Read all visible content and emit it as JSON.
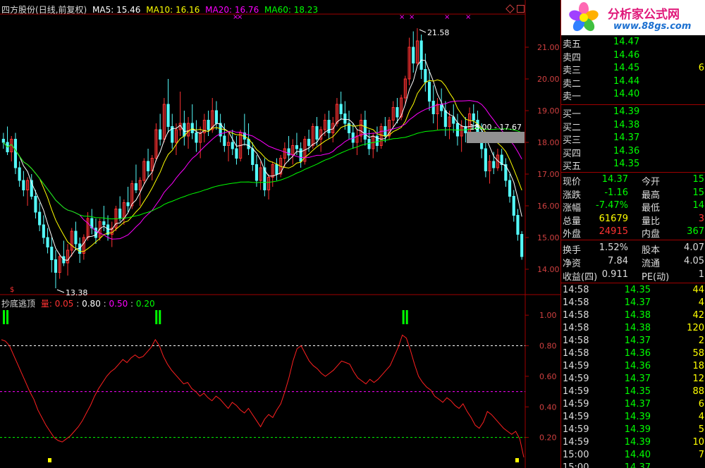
{
  "header": {
    "stock": "四方股份",
    "period": "(日线,前复权)",
    "ma5": "MA5: 15.46",
    "ma10": "MA10: 16.16",
    "ma20": "MA20: 16.76",
    "ma60": "MA60: 18.23"
  },
  "indicator_header": {
    "name": "抄底逃顶",
    "qty_label": "量:",
    "v1": "0.05",
    "v2": "0.80",
    "v3": "0.50",
    "v4": "0.20"
  },
  "price_labels": {
    "high": "21.58",
    "low": "13.38",
    "range": "18.00 - 17.67"
  },
  "logo": {
    "title": "分析家公式网",
    "url": "www.88gs.com"
  },
  "colors": {
    "up": "#ff3232",
    "down": "#54fcfc",
    "ma5": "#ffffff",
    "ma10": "#ffff00",
    "ma20": "#ff00ff",
    "ma60": "#00ff00",
    "grid": "#a00000",
    "price_green": "#00ff00"
  },
  "order_book": {
    "sell": [
      {
        "label": "卖五",
        "price": "14.47",
        "vol": ""
      },
      {
        "label": "卖四",
        "price": "14.46",
        "vol": ""
      },
      {
        "label": "卖三",
        "price": "14.45",
        "vol": "6"
      },
      {
        "label": "卖二",
        "price": "14.44",
        "vol": ""
      },
      {
        "label": "卖一",
        "price": "14.40",
        "vol": ""
      }
    ],
    "buy": [
      {
        "label": "买一",
        "price": "14.39",
        "vol": ""
      },
      {
        "label": "买二",
        "price": "14.38",
        "vol": ""
      },
      {
        "label": "买三",
        "price": "14.37",
        "vol": ""
      },
      {
        "label": "买四",
        "price": "14.36",
        "vol": ""
      },
      {
        "label": "买五",
        "price": "14.35",
        "vol": ""
      }
    ]
  },
  "quote": [
    {
      "l1": "现价",
      "v1": "14.37",
      "l2": "今开",
      "v2": "15",
      "c1": "#00ff00",
      "c2": "#00ff00"
    },
    {
      "l1": "涨跌",
      "v1": "-1.16",
      "l2": "最高",
      "v2": "15",
      "c1": "#00ff00",
      "c2": "#00ff00"
    },
    {
      "l1": "涨幅",
      "v1": "-7.47%",
      "l2": "最低",
      "v2": "14",
      "c1": "#00ff00",
      "c2": "#00ff00"
    },
    {
      "l1": "总量",
      "v1": "61679",
      "l2": "量比",
      "v2": "3",
      "c1": "#ffff00",
      "c2": "#ff3232"
    },
    {
      "l1": "外盘",
      "v1": "24915",
      "l2": "内盘",
      "v2": "367",
      "c1": "#ff3232",
      "c2": "#00ff00"
    }
  ],
  "fundamentals": [
    {
      "l1": "换手",
      "v1": "1.52%",
      "l2": "股本",
      "v2": "4.07"
    },
    {
      "l1": "净资",
      "v1": "7.84",
      "l2": "流通",
      "v2": "4.05"
    },
    {
      "l1": "收益(四)",
      "v1": "0.911",
      "l2": "PE(动)",
      "v2": "1"
    }
  ],
  "ticks": [
    {
      "t": "14:58",
      "p": "14.35",
      "v": "44"
    },
    {
      "t": "14:58",
      "p": "14.37",
      "v": "4"
    },
    {
      "t": "14:58",
      "p": "14.38",
      "v": "42"
    },
    {
      "t": "14:58",
      "p": "14.38",
      "v": "120"
    },
    {
      "t": "14:58",
      "p": "14.37",
      "v": "2"
    },
    {
      "t": "14:58",
      "p": "14.36",
      "v": "58"
    },
    {
      "t": "14:59",
      "p": "14.36",
      "v": "18"
    },
    {
      "t": "14:59",
      "p": "14.37",
      "v": "12"
    },
    {
      "t": "14:59",
      "p": "14.35",
      "v": "88"
    },
    {
      "t": "14:59",
      "p": "14.37",
      "v": "6"
    },
    {
      "t": "14:59",
      "p": "14.39",
      "v": "4"
    },
    {
      "t": "14:59",
      "p": "14.39",
      "v": "5"
    },
    {
      "t": "14:59",
      "p": "14.39",
      "v": "10"
    },
    {
      "t": "15:00",
      "p": "14.40",
      "v": "7"
    },
    {
      "t": "15:00",
      "p": "14.37",
      "v": ""
    }
  ],
  "chart_data": {
    "type": "candlestick",
    "price_axis": {
      "ticks": [
        "21.00",
        "20.00",
        "19.00",
        "18.00",
        "17.00",
        "16.00",
        "15.00",
        "14.00"
      ],
      "values": [
        21,
        20,
        19,
        18,
        17,
        16,
        15,
        14
      ],
      "ylim": [
        13.2,
        22.0
      ]
    },
    "indicator_axis": {
      "ticks": [
        "1.00",
        "0.80",
        "0.60",
        "0.40",
        "0.20"
      ],
      "values": [
        1.0,
        0.8,
        0.6,
        0.4,
        0.2
      ],
      "ylim": [
        0.0,
        1.07
      ]
    },
    "indicator_levels": [
      {
        "value": 0.8,
        "color": "#ffffff"
      },
      {
        "value": 0.5,
        "color": "#ff00ff"
      },
      {
        "value": 0.2,
        "color": "#00ff00"
      }
    ],
    "candles": [
      [
        18.1,
        18.3,
        17.8,
        18.0
      ],
      [
        18.0,
        18.5,
        17.6,
        17.7
      ],
      [
        17.7,
        18.2,
        17.4,
        18.1
      ],
      [
        18.1,
        18.3,
        17.0,
        17.2
      ],
      [
        17.2,
        17.4,
        16.6,
        16.8
      ],
      [
        16.8,
        17.1,
        16.3,
        16.5
      ],
      [
        16.5,
        16.9,
        16.0,
        16.8
      ],
      [
        16.8,
        17.0,
        16.2,
        16.3
      ],
      [
        16.3,
        16.5,
        15.6,
        15.8
      ],
      [
        15.8,
        16.1,
        15.2,
        15.4
      ],
      [
        15.4,
        15.7,
        14.8,
        15.0
      ],
      [
        15.0,
        15.3,
        14.5,
        14.7
      ],
      [
        14.7,
        15.0,
        13.9,
        14.3
      ],
      [
        14.3,
        14.6,
        13.4,
        13.9
      ],
      [
        13.9,
        14.5,
        13.7,
        14.4
      ],
      [
        14.4,
        14.9,
        14.1,
        14.2
      ],
      [
        14.2,
        14.8,
        13.8,
        14.6
      ],
      [
        14.6,
        15.3,
        14.4,
        15.2
      ],
      [
        15.2,
        15.5,
        14.6,
        14.8
      ],
      [
        14.8,
        15.0,
        14.2,
        14.5
      ],
      [
        14.5,
        15.1,
        14.3,
        15.0
      ],
      [
        15.0,
        15.8,
        14.9,
        15.6
      ],
      [
        15.6,
        15.9,
        15.1,
        15.3
      ],
      [
        15.3,
        15.6,
        14.8,
        15.0
      ],
      [
        15.0,
        15.6,
        14.9,
        15.5
      ],
      [
        15.5,
        16.0,
        15.2,
        15.4
      ],
      [
        15.4,
        15.7,
        14.9,
        15.1
      ],
      [
        15.1,
        15.5,
        14.7,
        15.3
      ],
      [
        15.3,
        16.0,
        15.2,
        15.9
      ],
      [
        15.9,
        16.3,
        15.5,
        15.6
      ],
      [
        15.6,
        16.2,
        15.4,
        16.1
      ],
      [
        16.1,
        16.6,
        15.8,
        16.0
      ],
      [
        16.0,
        16.8,
        15.9,
        16.7
      ],
      [
        16.7,
        17.3,
        16.4,
        16.5
      ],
      [
        16.5,
        16.9,
        16.0,
        16.8
      ],
      [
        16.8,
        17.5,
        16.7,
        17.4
      ],
      [
        17.4,
        17.8,
        16.9,
        17.1
      ],
      [
        17.1,
        17.6,
        16.8,
        17.5
      ],
      [
        17.5,
        18.6,
        17.4,
        18.4
      ],
      [
        18.4,
        18.9,
        17.9,
        18.1
      ],
      [
        18.1,
        19.4,
        18.0,
        19.2
      ],
      [
        19.2,
        20.0,
        18.3,
        18.5
      ],
      [
        18.5,
        18.9,
        17.8,
        18.0
      ],
      [
        18.0,
        18.6,
        17.6,
        18.4
      ],
      [
        18.4,
        19.6,
        18.2,
        18.6
      ],
      [
        18.6,
        19.0,
        17.9,
        18.2
      ],
      [
        18.2,
        18.8,
        17.8,
        18.6
      ],
      [
        18.6,
        19.2,
        18.1,
        18.3
      ],
      [
        18.3,
        18.7,
        17.7,
        18.0
      ],
      [
        18.0,
        18.5,
        17.5,
        18.3
      ],
      [
        18.3,
        18.9,
        18.0,
        18.7
      ],
      [
        18.7,
        19.0,
        18.2,
        18.4
      ],
      [
        18.4,
        19.4,
        18.3,
        19.0
      ],
      [
        19.0,
        19.3,
        18.4,
        18.6
      ],
      [
        18.6,
        18.9,
        18.0,
        18.2
      ],
      [
        18.2,
        18.6,
        17.7,
        17.9
      ],
      [
        17.9,
        18.3,
        17.4,
        18.0
      ],
      [
        18.0,
        18.4,
        17.6,
        17.8
      ],
      [
        17.8,
        18.2,
        17.3,
        17.5
      ],
      [
        17.5,
        18.4,
        17.4,
        18.3
      ],
      [
        18.3,
        18.9,
        17.9,
        18.1
      ],
      [
        18.1,
        18.6,
        17.6,
        17.8
      ],
      [
        17.8,
        18.0,
        17.1,
        17.3
      ],
      [
        17.3,
        17.6,
        16.6,
        16.8
      ],
      [
        16.8,
        17.4,
        16.5,
        17.2
      ],
      [
        17.2,
        17.5,
        16.3,
        16.5
      ],
      [
        16.5,
        17.0,
        16.2,
        16.9
      ],
      [
        16.9,
        17.4,
        16.6,
        17.3
      ],
      [
        17.3,
        17.5,
        16.8,
        17.0
      ],
      [
        17.0,
        17.6,
        16.9,
        17.5
      ],
      [
        17.5,
        18.0,
        17.2,
        17.8
      ],
      [
        17.8,
        18.2,
        17.4,
        17.6
      ],
      [
        17.6,
        18.1,
        17.3,
        17.9
      ],
      [
        17.9,
        18.3,
        17.6,
        17.8
      ],
      [
        17.8,
        18.0,
        17.2,
        17.4
      ],
      [
        17.4,
        18.2,
        17.3,
        18.1
      ],
      [
        18.1,
        18.4,
        17.7,
        17.9
      ],
      [
        17.9,
        18.6,
        17.8,
        18.5
      ],
      [
        18.5,
        18.8,
        17.9,
        18.1
      ],
      [
        18.1,
        18.5,
        17.7,
        18.4
      ],
      [
        18.4,
        18.9,
        18.2,
        18.7
      ],
      [
        18.7,
        19.0,
        18.1,
        18.3
      ],
      [
        18.3,
        18.8,
        18.0,
        18.6
      ],
      [
        18.6,
        19.4,
        18.5,
        19.2
      ],
      [
        19.2,
        19.6,
        18.7,
        18.9
      ],
      [
        18.9,
        19.3,
        18.4,
        18.6
      ],
      [
        18.6,
        19.0,
        18.1,
        18.3
      ],
      [
        18.3,
        18.6,
        17.8,
        18.0
      ],
      [
        18.0,
        18.4,
        17.6,
        18.2
      ],
      [
        18.2,
        18.9,
        18.0,
        18.7
      ],
      [
        18.7,
        19.0,
        17.9,
        18.1
      ],
      [
        18.1,
        18.4,
        17.6,
        17.8
      ],
      [
        17.8,
        18.3,
        17.5,
        18.2
      ],
      [
        18.2,
        18.5,
        17.7,
        17.9
      ],
      [
        17.9,
        18.6,
        17.8,
        18.5
      ],
      [
        18.5,
        18.8,
        18.0,
        18.2
      ],
      [
        18.2,
        18.8,
        18.1,
        18.7
      ],
      [
        18.7,
        19.3,
        18.5,
        19.1
      ],
      [
        19.1,
        19.4,
        18.6,
        18.8
      ],
      [
        18.8,
        19.5,
        18.7,
        19.4
      ],
      [
        19.4,
        20.1,
        19.2,
        20.0
      ],
      [
        20.0,
        21.3,
        19.8,
        21.0
      ],
      [
        21.0,
        21.5,
        20.2,
        20.5
      ],
      [
        20.5,
        21.6,
        20.4,
        21.2
      ],
      [
        21.2,
        21.4,
        20.0,
        20.3
      ],
      [
        20.3,
        20.8,
        19.6,
        19.9
      ],
      [
        19.9,
        20.3,
        19.0,
        19.3
      ],
      [
        19.3,
        19.8,
        18.6,
        18.9
      ],
      [
        18.9,
        19.4,
        18.4,
        19.2
      ],
      [
        19.2,
        19.7,
        18.8,
        19.0
      ],
      [
        19.0,
        19.3,
        18.2,
        18.5
      ],
      [
        18.5,
        19.0,
        18.1,
        18.8
      ],
      [
        18.8,
        19.2,
        18.3,
        18.6
      ],
      [
        18.6,
        18.9,
        17.9,
        18.2
      ],
      [
        18.2,
        18.7,
        17.7,
        18.5
      ],
      [
        18.5,
        18.8,
        18.0,
        18.3
      ],
      [
        18.3,
        19.1,
        18.2,
        18.9
      ],
      [
        18.9,
        19.2,
        18.4,
        18.7
      ],
      [
        18.7,
        19.0,
        18.0,
        18.3
      ],
      [
        18.3,
        18.6,
        17.5,
        17.8
      ],
      [
        17.8,
        18.0,
        16.9,
        17.1
      ],
      [
        17.1,
        17.6,
        16.7,
        17.4
      ],
      [
        17.4,
        17.7,
        17.0,
        17.2
      ],
      [
        17.2,
        17.8,
        17.1,
        17.6
      ],
      [
        17.6,
        17.8,
        17.1,
        17.3
      ],
      [
        17.3,
        17.5,
        16.6,
        16.8
      ],
      [
        16.8,
        17.0,
        16.1,
        16.3
      ],
      [
        16.3,
        16.5,
        15.5,
        15.7
      ],
      [
        15.7,
        15.9,
        14.9,
        15.1
      ],
      [
        15.1,
        15.2,
        14.3,
        14.4
      ]
    ],
    "indicator": [
      0.84,
      0.83,
      0.8,
      0.74,
      0.68,
      0.62,
      0.56,
      0.5,
      0.45,
      0.38,
      0.33,
      0.28,
      0.24,
      0.2,
      0.18,
      0.17,
      0.19,
      0.21,
      0.24,
      0.27,
      0.31,
      0.36,
      0.41,
      0.47,
      0.52,
      0.56,
      0.6,
      0.63,
      0.65,
      0.68,
      0.71,
      0.69,
      0.72,
      0.74,
      0.72,
      0.73,
      0.76,
      0.79,
      0.84,
      0.8,
      0.73,
      0.68,
      0.64,
      0.61,
      0.58,
      0.55,
      0.56,
      0.52,
      0.5,
      0.47,
      0.49,
      0.46,
      0.44,
      0.47,
      0.45,
      0.42,
      0.39,
      0.43,
      0.41,
      0.38,
      0.36,
      0.39,
      0.35,
      0.31,
      0.27,
      0.32,
      0.35,
      0.33,
      0.38,
      0.42,
      0.5,
      0.59,
      0.7,
      0.78,
      0.8,
      0.75,
      0.7,
      0.67,
      0.65,
      0.62,
      0.6,
      0.62,
      0.64,
      0.67,
      0.7,
      0.69,
      0.68,
      0.63,
      0.59,
      0.57,
      0.55,
      0.58,
      0.56,
      0.58,
      0.61,
      0.64,
      0.67,
      0.73,
      0.79,
      0.87,
      0.85,
      0.77,
      0.68,
      0.6,
      0.56,
      0.53,
      0.51,
      0.47,
      0.45,
      0.43,
      0.46,
      0.44,
      0.41,
      0.39,
      0.42,
      0.37,
      0.33,
      0.28,
      0.26,
      0.3,
      0.37,
      0.35,
      0.32,
      0.29,
      0.26,
      0.24,
      0.22,
      0.24,
      0.19,
      0.07
    ],
    "markers": [
      {
        "type": "buy",
        "index": 0
      },
      {
        "type": "sell",
        "index": 38
      },
      {
        "type": "sell",
        "index": 99
      }
    ]
  }
}
